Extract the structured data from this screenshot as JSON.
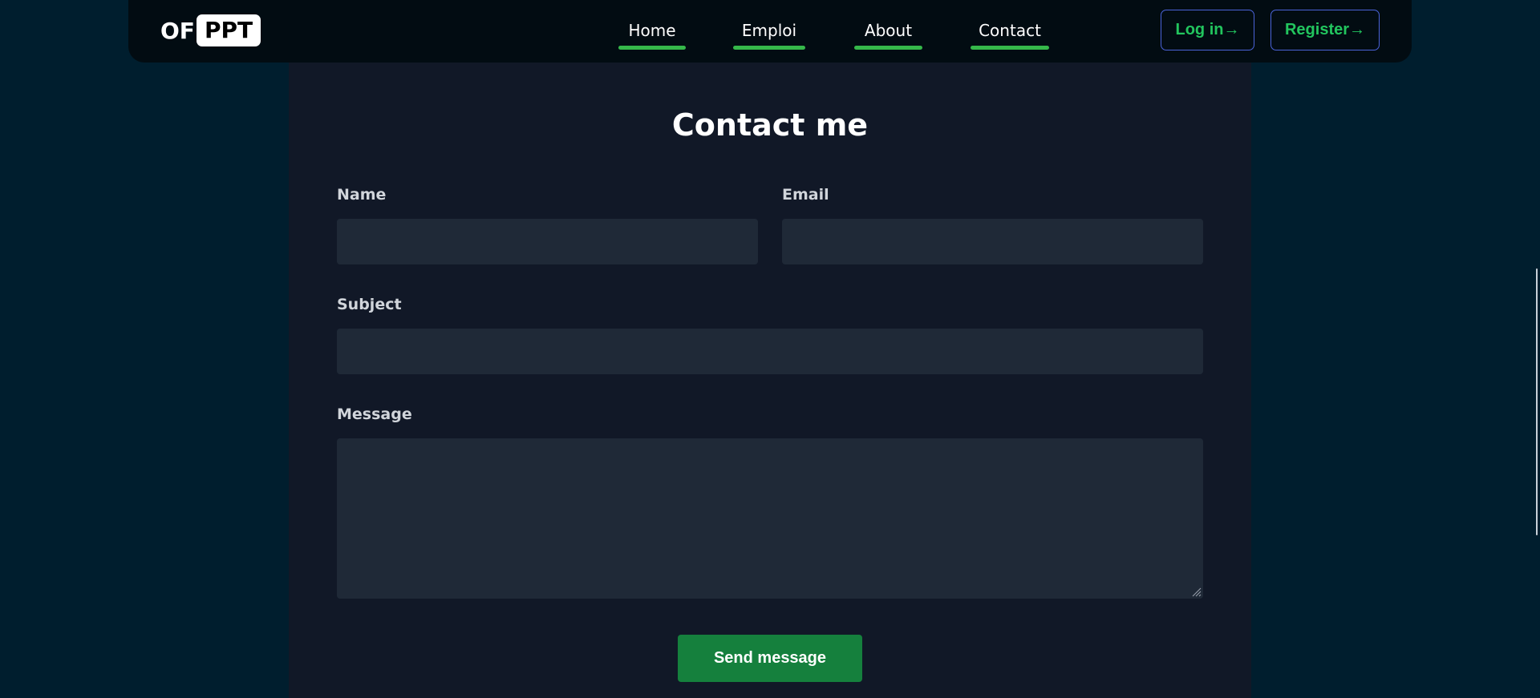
{
  "navbar": {
    "logo": {
      "left": "OF",
      "right": "PPT"
    },
    "links": [
      {
        "label": "Home"
      },
      {
        "label": "Emploi"
      },
      {
        "label": "About"
      },
      {
        "label": "Contact"
      }
    ],
    "login_label": "Log in→",
    "register_label": "Register→"
  },
  "contact": {
    "title": "Contact me",
    "name_label": "Name",
    "email_label": "Email",
    "subject_label": "Subject",
    "message_label": "Message",
    "name_value": "",
    "email_value": "",
    "subject_value": "",
    "message_value": "",
    "submit_label": "Send message"
  },
  "colors": {
    "page_background": "#001e2e",
    "navbar_background": "#020c12",
    "panel_background": "#111827",
    "input_background": "#1f2937",
    "accent_green": "#22c55e",
    "button_green": "#15803d",
    "underline_green": "#35b84a",
    "auth_border": "#4a63d8"
  }
}
